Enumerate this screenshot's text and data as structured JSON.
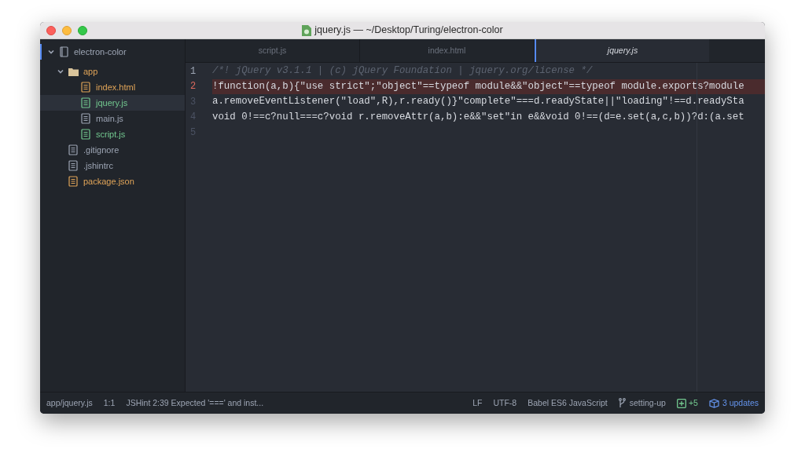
{
  "window": {
    "title": "jquery.js — ~/Desktop/Turing/electron-color"
  },
  "tree": {
    "label": "electron-color",
    "expanded": true,
    "children": [
      {
        "label": "app",
        "kind": "folder",
        "expanded": true,
        "children": [
          {
            "label": "index.html",
            "kind": "file",
            "color": "#e0a458",
            "selected": false
          },
          {
            "label": "jquery.js",
            "kind": "file",
            "color": "#73c990",
            "selected": true
          },
          {
            "label": "main.js",
            "kind": "file",
            "color": "#9da5b4",
            "selected": false
          },
          {
            "label": "script.js",
            "kind": "file",
            "color": "#73c990",
            "selected": false
          }
        ]
      },
      {
        "label": ".gitignore",
        "kind": "file",
        "color": "#9da5b4",
        "selected": false
      },
      {
        "label": ".jshintrc",
        "kind": "file",
        "color": "#9da5b4",
        "selected": false
      },
      {
        "label": "package.json",
        "kind": "file",
        "color": "#e0a458",
        "selected": false
      }
    ]
  },
  "tabs": [
    {
      "label": "script.js",
      "selected": false
    },
    {
      "label": "index.html",
      "selected": false
    },
    {
      "label": "jquery.js",
      "selected": true
    }
  ],
  "lines": [
    {
      "number": "1",
      "kind": "comment",
      "error": false,
      "text": "/*! jQuery v3.1.1 | (c) jQuery Foundation | jquery.org/license */"
    },
    {
      "number": "2",
      "kind": "code",
      "error": true,
      "text": "!function(a,b){\"use strict\";\"object\"==typeof module&&\"object\"==typeof module.exports?module"
    },
    {
      "number": "3",
      "kind": "code",
      "error": false,
      "text": "a.removeEventListener(\"load\",R),r.ready()}\"complete\"===d.readyState||\"loading\"!==d.readySta"
    },
    {
      "number": "4",
      "kind": "code",
      "error": false,
      "text": "void 0!==c?null===c?void r.removeAttr(a,b):e&&\"set\"in e&&void 0!==(d=e.set(a,c,b))?d:(a.set"
    },
    {
      "number": "5",
      "error": false
    }
  ],
  "status_bar": {
    "path": "app/jquery.js",
    "cursor": "1:1",
    "lint": "JSHint 2:39 Expected '===' and inst...",
    "line_ending": "LF",
    "encoding": "UTF-8",
    "grammar": "Babel ES6 JavaScript",
    "branch": "setting-up",
    "changes": "+5",
    "updates": "3 updates"
  }
}
